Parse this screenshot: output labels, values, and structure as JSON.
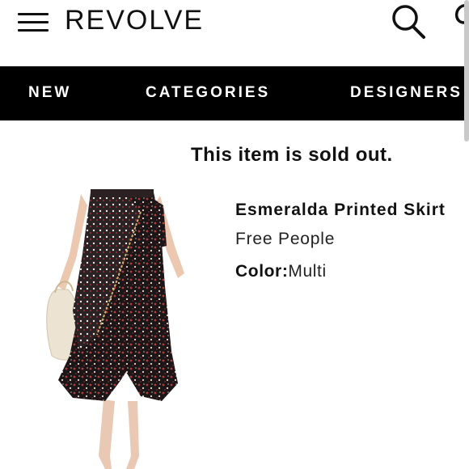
{
  "header": {
    "logo": "REVOLVE",
    "icons": [
      "hamburger-menu-icon",
      "search-icon",
      "shopping-bag-icon"
    ]
  },
  "nav": {
    "items": [
      {
        "label": "NEW"
      },
      {
        "label": "CATEGORIES"
      },
      {
        "label": "DESIGNERS"
      }
    ]
  },
  "notice": "This item is sold out.",
  "product": {
    "name": "Esmeralda Printed Skirt",
    "brand": "Free People",
    "color_label": "Color:",
    "color_value": "Multi"
  }
}
